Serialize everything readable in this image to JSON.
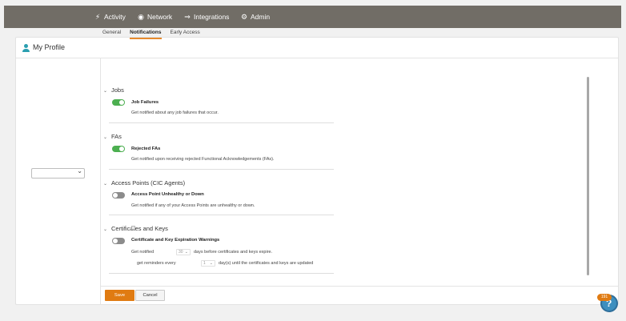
{
  "nav": {
    "items": [
      {
        "label": "Activity",
        "icon": "activity-icon"
      },
      {
        "label": "Network",
        "icon": "network-icon"
      },
      {
        "label": "Integrations",
        "icon": "integrations-icon"
      },
      {
        "label": "Admin",
        "icon": "gear-icon"
      }
    ]
  },
  "profile": {
    "title": "My Profile"
  },
  "left_select": {
    "value": ""
  },
  "tabs": [
    {
      "label": "General",
      "active": false
    },
    {
      "label": "Notifications",
      "active": true
    },
    {
      "label": "Early Access",
      "active": false
    }
  ],
  "sections": [
    {
      "title": "Jobs",
      "items": [
        {
          "label": "Job Failures",
          "enabled": true,
          "description": "Get notified about any job failures that occur."
        }
      ]
    },
    {
      "title": "FAs",
      "items": [
        {
          "label": "Rejected FAs",
          "enabled": true,
          "description": "Get notified upon receiving rejected Functional Acknowledgements (FAs)."
        }
      ]
    },
    {
      "title": "Access Points (CIC Agents)",
      "items": [
        {
          "label": "Access Point Unhealthy or Down",
          "enabled": false,
          "description": "Get notified if any of your Access Points are unhealthy or down."
        }
      ]
    },
    {
      "title": "Certificates and Keys",
      "items": [
        {
          "label": "Certificate and Key Expiration Warnings",
          "enabled": false,
          "get_notified_prefix": "Get notified",
          "days_value": "30",
          "days_suffix": "days before certificates and keys expire.",
          "reminder_checked": false,
          "reminder_prefix": "get reminders every",
          "reminder_value": "1",
          "reminder_suffix": "day(s) until the certificates and keys are updated"
        }
      ]
    }
  ],
  "footer": {
    "save_label": "Save",
    "cancel_label": "Cancel"
  },
  "help": {
    "badge_count": "191",
    "glyph": "?"
  },
  "colors": {
    "topbar": "#716d66",
    "accent": "#e07b12",
    "toggle_on": "#4caf50",
    "toggle_off": "#8c8c8c",
    "profile_icon": "#2a9fb0",
    "help": "#3d8fbf"
  }
}
